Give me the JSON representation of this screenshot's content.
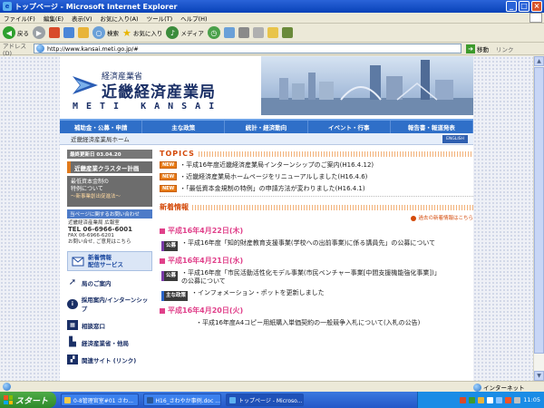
{
  "window": {
    "title": "トップページ - Microsoft Internet Explorer"
  },
  "menu": [
    "ファイル(F)",
    "編集(E)",
    "表示(V)",
    "お気に入り(A)",
    "ツール(T)",
    "ヘルプ(H)"
  ],
  "toolbar": {
    "back": "戻る",
    "search": "検索",
    "favorites": "お気に入り",
    "media": "メディア"
  },
  "address": {
    "label": "アドレス(D)",
    "url": "http://www.kansai.meti.go.jp/#",
    "go": "移動",
    "links": "リンク"
  },
  "header": {
    "ministry": "経済産業省",
    "bureau": "近畿経済産業局",
    "meti": "METI KANSAI"
  },
  "nav": [
    "補助金・公募・申請",
    "主な政策",
    "統計・経済動向",
    "イベント・行事",
    "報告書・報道発表"
  ],
  "breadcrumb": "近畿経済産業局ホーム",
  "english": "ENGLISH",
  "sidebar": {
    "updated": "最終更新日 03.04.20",
    "banner1": "近畿産業クラスター計画",
    "banner2_line1": "最低資本金制の",
    "banner2_line2": "特例について",
    "banner2_sub": "～新事業創出促進法～",
    "contact_heading": "当ページに関するお問い合わせ",
    "contact_org": "近畿経済産業局 広報室",
    "contact_tel": "TEL 06-6966-6001",
    "contact_fax": "FAX 06-6966-6201",
    "contact_mail": "お問い合せ, ご意見はこちら",
    "mail_service_l1": "新着情報",
    "mail_service_l2": "配信サービス",
    "menu": [
      {
        "label": "局のご案内"
      },
      {
        "label": "採用案内/インターンシップ"
      },
      {
        "label": "相談窓口"
      },
      {
        "label": "経済産業省・他局"
      },
      {
        "label": "関連サイト (リンク)"
      }
    ]
  },
  "topics": {
    "heading": "TOPICS",
    "badge": "NEW",
    "items": [
      "・平成16年度近畿経済産業局インターンシップのご案内(H16.4.12)",
      "・近畿経済産業局ホームページをリニューアルしました(H16.4.6)",
      "・「最低資本金規制の特例」の申請方法が変わりました(H16.4.1)"
    ]
  },
  "news": {
    "heading": "新着情報",
    "past_link": "過去の新着情報はこちら",
    "dates": [
      {
        "date": "平成16年4月22日(木)",
        "entries": [
          {
            "category": "公募",
            "text": "・平成16年度「知的財産教育支援事業(学校への出前事業)に係る講員先」の公募について"
          }
        ]
      },
      {
        "date": "平成16年4月21日(水)",
        "entries": [
          {
            "category": "公募",
            "text": "・平成16年度「市民活動活性化モデル事業(市民ベンチャー事業[中間支援機能強化事業])」の公募について"
          },
          {
            "category": "主な政策",
            "text": "・インフォメーション・ポットを更新しました"
          }
        ]
      },
      {
        "date": "平成16年4月20日(火)",
        "entries": [
          {
            "category": "",
            "text": "・平成16年度A4コピー用紙購入単価契約の一般競争入札について(入札の公告)"
          }
        ]
      }
    ]
  },
  "status": {
    "zone": "インターネット"
  },
  "taskbar": {
    "start": "スタート",
    "tasks": [
      "0-8管理官室#01 さわ...",
      "H16_さわやか事例.doc ...",
      "トップページ - Microso..."
    ],
    "clock": "11:05"
  }
}
